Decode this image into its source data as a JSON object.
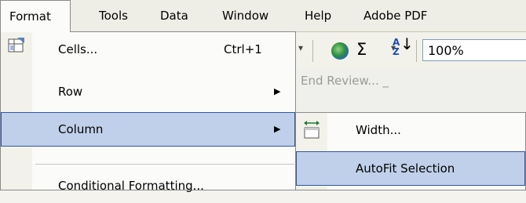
{
  "menubar": {
    "items": [
      {
        "id": "format",
        "label": "Format"
      },
      {
        "id": "tools",
        "label": "Tools"
      },
      {
        "id": "data",
        "label": "Data"
      },
      {
        "id": "window",
        "label": "Window"
      },
      {
        "id": "help",
        "label": "Help"
      },
      {
        "id": "adobe",
        "label": "Adobe PDF"
      }
    ]
  },
  "toolbar": {
    "sum_symbol": "Σ",
    "dropdown_glyph": "▾",
    "sort_top": "A",
    "sort_bottom": "Z",
    "sort_arrow": "↓",
    "zoom_value": "100%",
    "end_review": "End Review... _"
  },
  "format_menu": {
    "items": [
      {
        "id": "cells",
        "label": "Cells...",
        "shortcut": "Ctrl+1",
        "icon": "format-cells-icon"
      },
      {
        "id": "row",
        "label": "Row",
        "submenu": true
      },
      {
        "id": "column",
        "label": "Column",
        "submenu": true,
        "highlighted": true
      },
      {
        "id": "conditional",
        "label": "Conditional Formatting..."
      }
    ],
    "submenu_arrow": "▶"
  },
  "column_submenu": {
    "items": [
      {
        "id": "width",
        "label": "Width...",
        "icon": "column-width-icon"
      },
      {
        "id": "autofit",
        "label": "AutoFit Selection",
        "highlighted": true
      }
    ]
  },
  "colors": {
    "highlight": "#c0d0ea",
    "highlight_border": "#31579c",
    "menu_bg": "#fbfbf9"
  }
}
